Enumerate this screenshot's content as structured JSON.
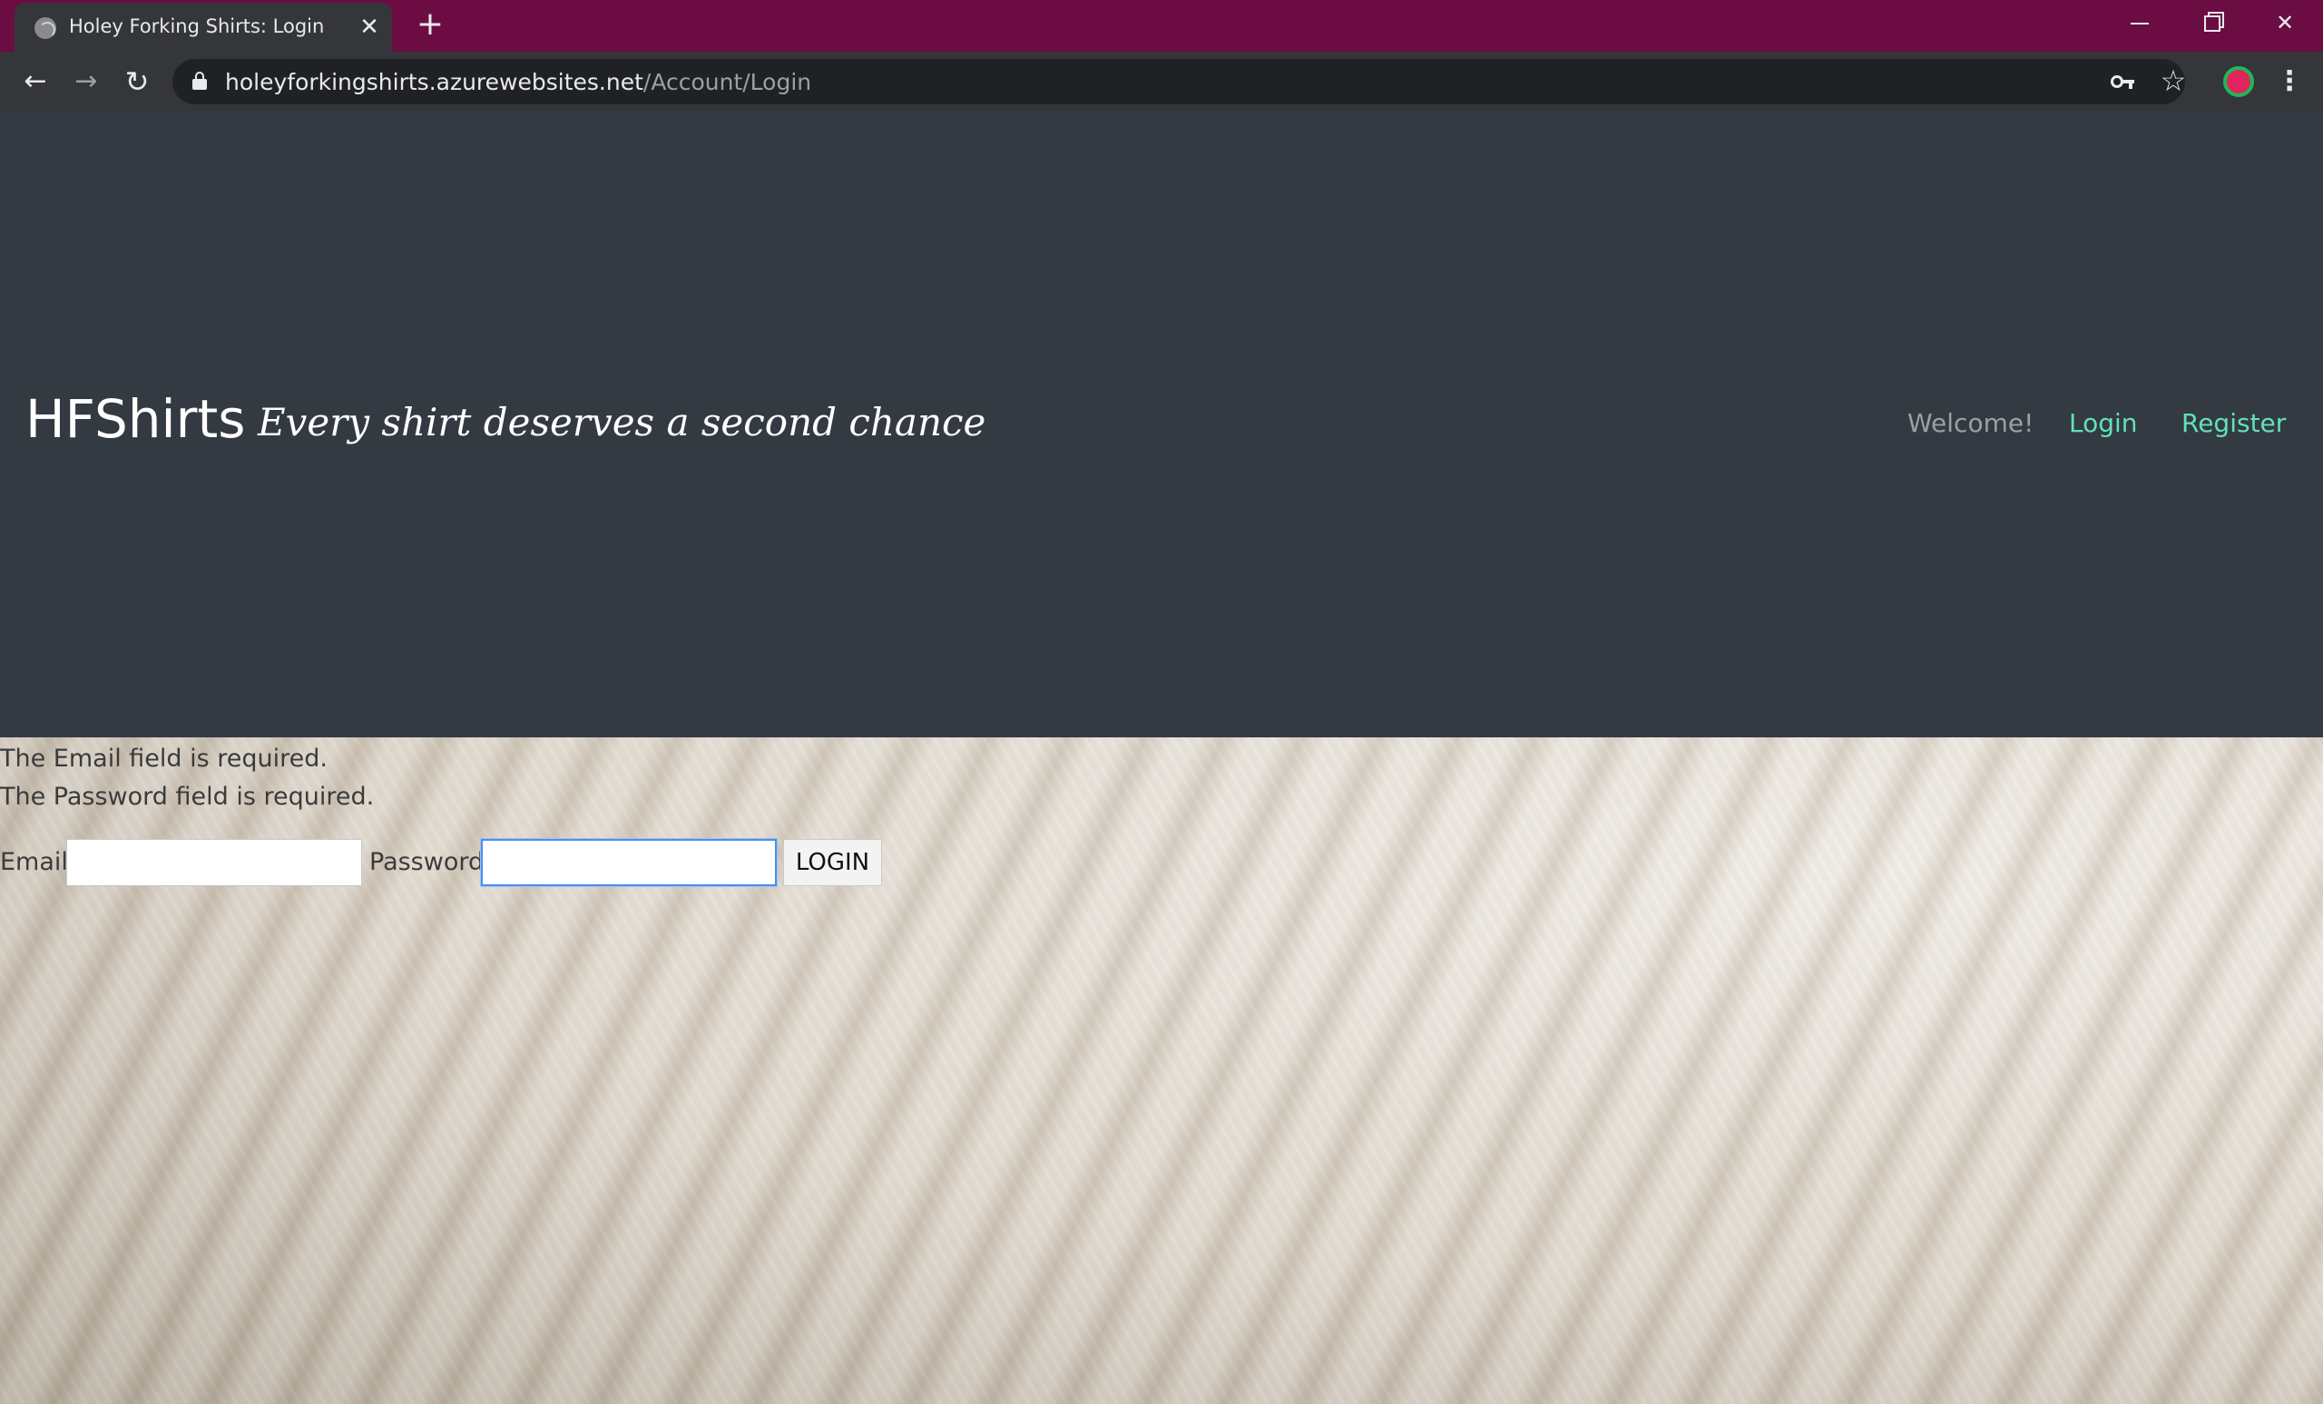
{
  "browser": {
    "tab_title": "Holey Forking Shirts: Login",
    "url_host": "holeyforkingshirts.azurewebsites.net",
    "url_path": "/Account/Login",
    "icons": {
      "favicon": "globe-icon",
      "close": "close-icon",
      "new_tab": "plus-icon",
      "back": "back-arrow-icon",
      "forward": "forward-arrow-icon",
      "reload": "reload-icon",
      "lock": "lock-icon",
      "key": "key-icon",
      "bookmark": "star-icon",
      "profile": "profile-avatar-icon",
      "menu": "kebab-menu-icon"
    },
    "colors": {
      "titlebar": "#6b0d43",
      "toolbar": "#35363a",
      "omnibox": "#202124"
    }
  },
  "site": {
    "brand": "HFShirts",
    "tagline": "Every shirt deserves a second chance",
    "nav": {
      "welcome": "Welcome!",
      "login": "Login",
      "register": "Register"
    },
    "colors": {
      "header_bg": "#343a42",
      "nav_link": "#61e0bd"
    }
  },
  "login_form": {
    "errors": [
      "The Email field is required.",
      "The Password field is required."
    ],
    "email_label": "Email",
    "email_value": "",
    "password_label": "Password",
    "password_value": "",
    "submit_label": "LOGIN"
  }
}
